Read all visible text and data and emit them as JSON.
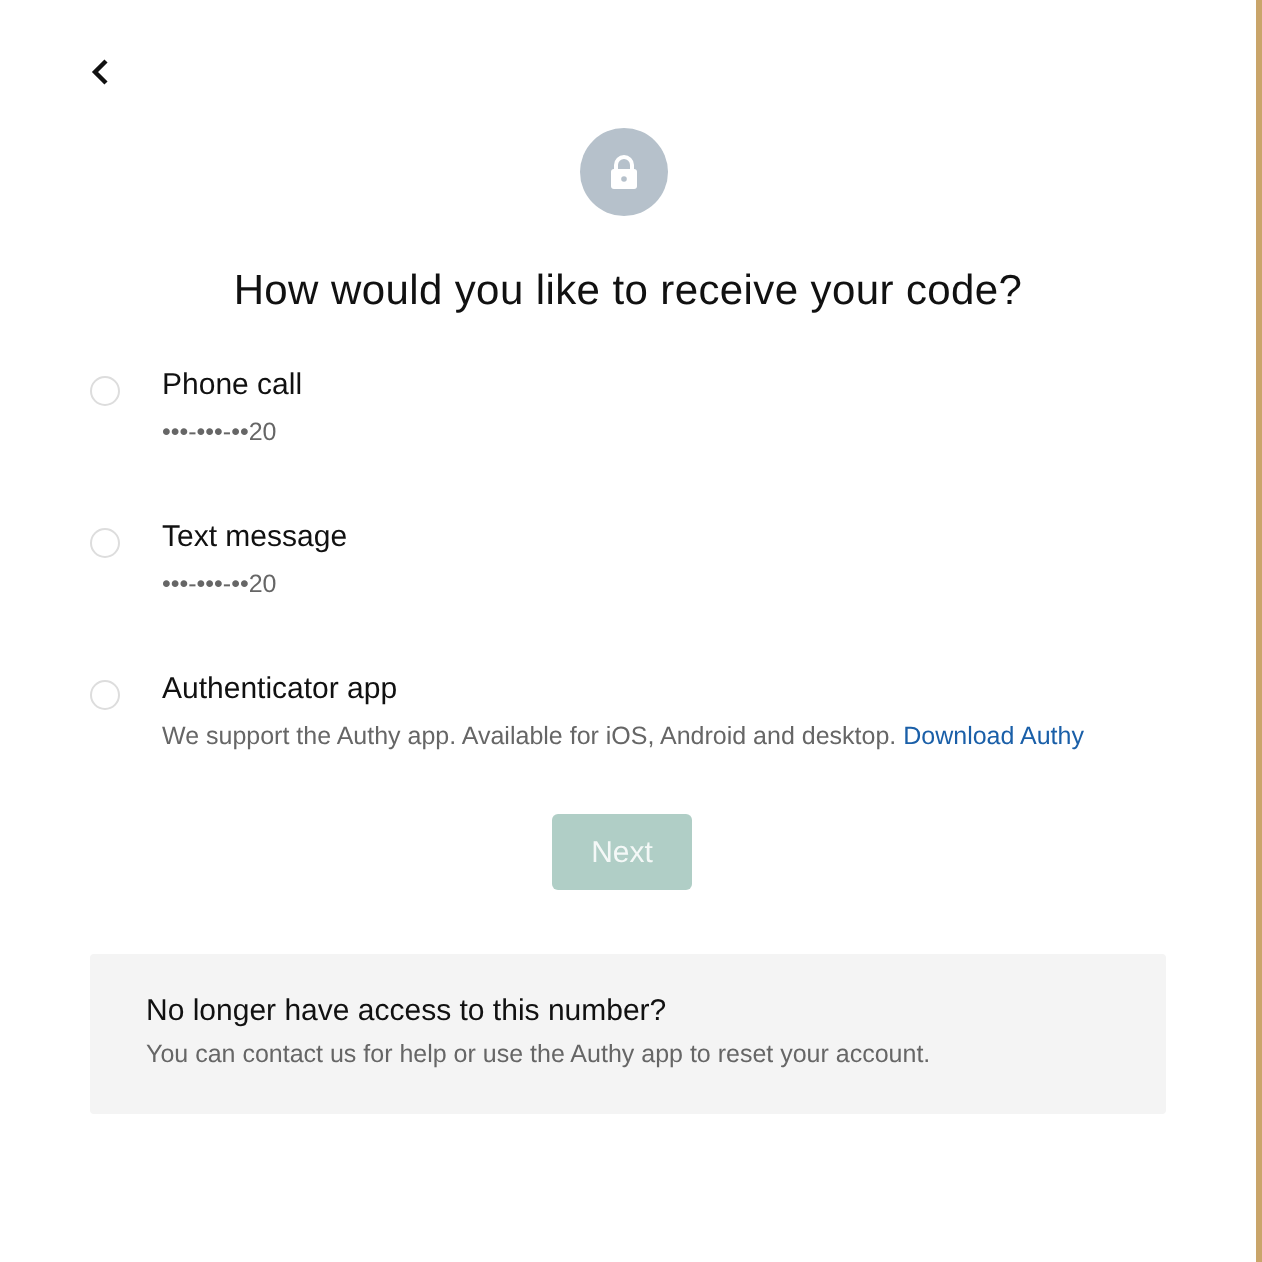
{
  "title": "How would you like to receive your code?",
  "options": [
    {
      "label": "Phone call",
      "selected": false,
      "detail": "•••-•••-••20"
    },
    {
      "label": "Text message",
      "selected": false,
      "detail": "•••-•••-••20"
    },
    {
      "label": "Authenticator app",
      "selected": false,
      "detail": "We support the Authy app. Available for iOS, Android and desktop.",
      "link": "Download Authy"
    }
  ],
  "next_button": {
    "label": "Next",
    "disabled": true
  },
  "help_panel": {
    "heading": "No longer have access to this number?",
    "text": "You can contact us for help or use the Authy app to reset your account."
  }
}
